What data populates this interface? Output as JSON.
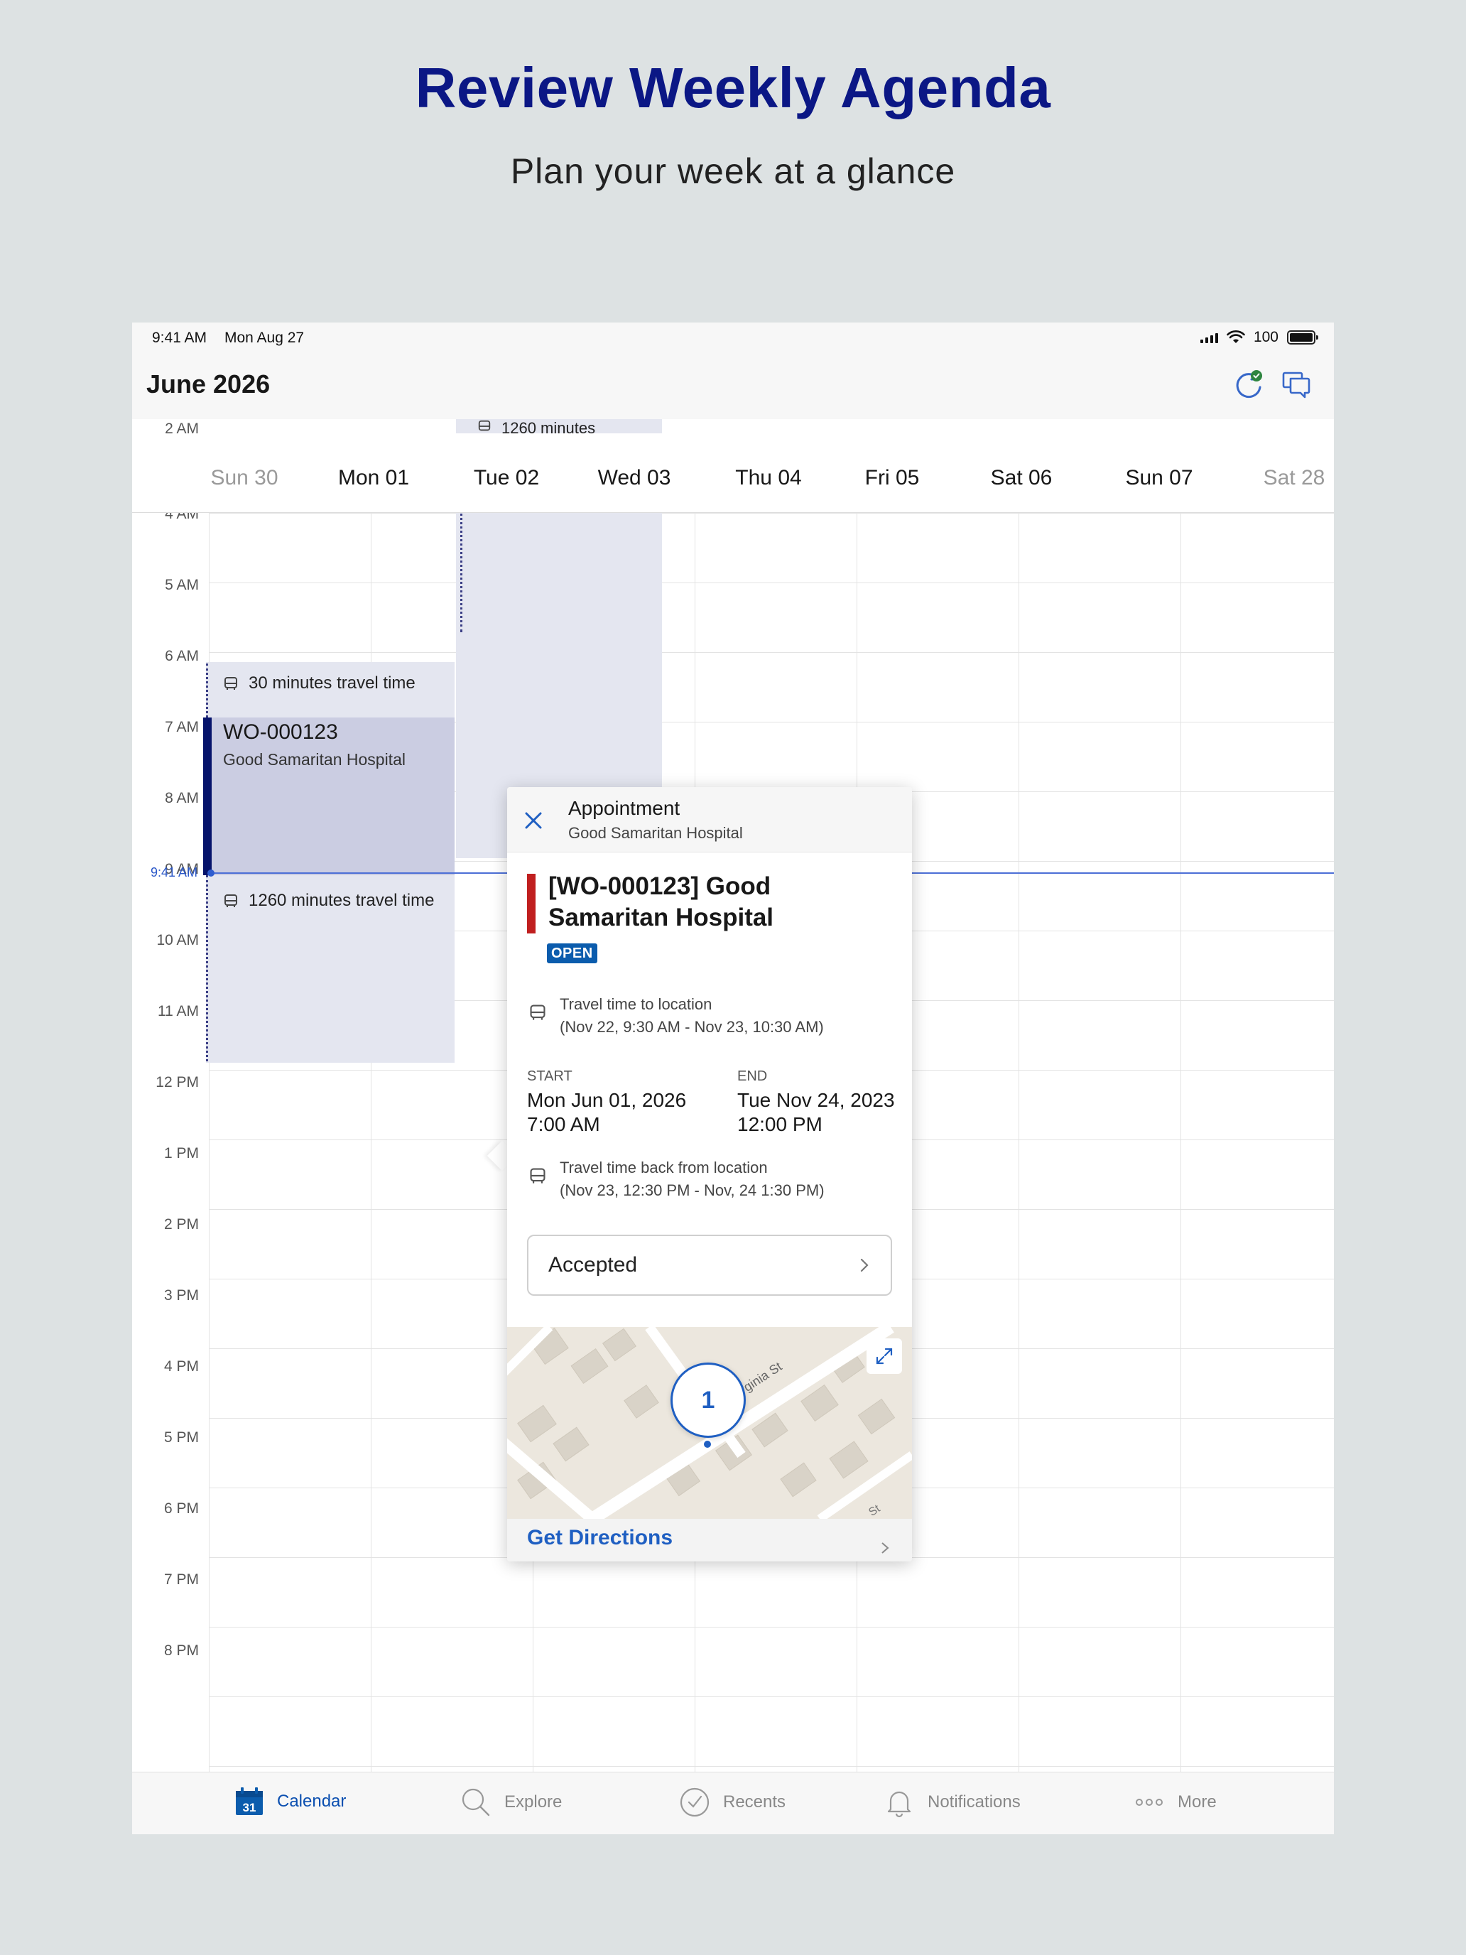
{
  "promo": {
    "headline": "Review Weekly Agenda",
    "subheadline": "Plan your week at a glance"
  },
  "status_bar": {
    "time": "9:41 AM",
    "date": "Mon Aug 27",
    "battery": "100"
  },
  "header": {
    "title": "June 2026",
    "sync_icon": "sync-icon",
    "chat_icon": "chat-icon"
  },
  "calendar": {
    "days": [
      {
        "label": "Sun 30",
        "muted": true
      },
      {
        "label": "Mon 01",
        "muted": false
      },
      {
        "label": "Tue 02",
        "muted": false
      },
      {
        "label": "Wed 03",
        "muted": false
      },
      {
        "label": "Thu 04",
        "muted": false
      },
      {
        "label": "Fri 05",
        "muted": false
      },
      {
        "label": "Sat 06",
        "muted": false
      },
      {
        "label": "Sun 07",
        "muted": false
      },
      {
        "label": "Sat 28",
        "muted": true
      }
    ],
    "hours": [
      "2 AM",
      "4 AM",
      "5 AM",
      "6 AM",
      "7 AM",
      "8 AM",
      "9 AM",
      "10 AM",
      "11 AM",
      "12 PM",
      "1 PM",
      "2 PM",
      "3 PM",
      "4 PM",
      "5 PM",
      "6 PM",
      "7 PM",
      "8 PM"
    ],
    "now_label": "9:41 AM",
    "events": {
      "top_travel": "1260 minutes",
      "travel_before": "30 minutes travel time",
      "work_order": "WO-000123",
      "location": "Good Samaritan Hospital",
      "travel_after": "1260 minutes travel time"
    }
  },
  "popover": {
    "header_title": "Appointment",
    "header_subtitle": "Good Samaritan Hospital",
    "title": "[WO-000123] Good Samaritan Hospital",
    "status_badge": "OPEN",
    "travel_to_label": "Travel time to location",
    "travel_to_range": "(Nov 22, 9:30 AM - Nov 23, 10:30 AM)",
    "start_label": "START",
    "start_date": "Mon Jun 01, 2026",
    "start_time": "7:00 AM",
    "end_label": "END",
    "end_date": "Tue Nov 24, 2023",
    "end_time": "12:00 PM",
    "travel_back_label": "Travel time back from location",
    "travel_back_range": "(Nov 23, 12:30 PM - Nov, 24 1:30 PM)",
    "response": "Accepted",
    "map_marker": "1",
    "map_street_1": "ginia St",
    "map_street_2": "St",
    "directions": "Get Directions"
  },
  "tab_bar": {
    "calendar_day": "31",
    "items": [
      {
        "label": "Calendar",
        "icon": "calendar-icon",
        "active": true
      },
      {
        "label": "Explore",
        "icon": "search-icon",
        "active": false
      },
      {
        "label": "Recents",
        "icon": "clock-icon",
        "active": false
      },
      {
        "label": "Notifications",
        "icon": "bell-icon",
        "active": false
      },
      {
        "label": "More",
        "icon": "more-icon",
        "active": false
      }
    ]
  },
  "colors": {
    "promo_background": "#dde2e3",
    "headline": "#0b1785",
    "event_accent": "#06136b",
    "event_fill": "#cbcde2",
    "travel_fill": "#e4e6f0",
    "now_line": "#4c6fd6",
    "status_open": "#0b5cad",
    "priority_bar": "#c01f1f",
    "link": "#1f5fc2"
  }
}
